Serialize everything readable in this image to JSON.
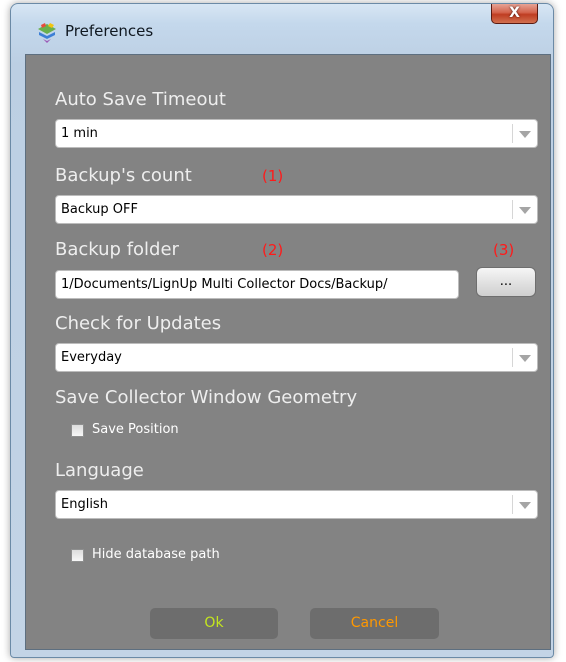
{
  "window": {
    "title": "Preferences",
    "close_glyph": "X",
    "icon": "app-multicolor-icon"
  },
  "auto_save": {
    "label": "Auto Save Timeout",
    "value": "1 min"
  },
  "backup_count": {
    "label": "Backup's count",
    "marker": "(1)",
    "value": "Backup OFF"
  },
  "backup_folder": {
    "label": "Backup folder",
    "marker": "(2)",
    "browse_marker": "(3)",
    "path": "1/Documents/LignUp Multi Collector Docs/Backup/",
    "browse_label": "..."
  },
  "updates": {
    "label": "Check for Updates",
    "value": "Everyday"
  },
  "geometry": {
    "label": "Save Collector Window Geometry",
    "save_position_label": "Save Position",
    "save_position_checked": false
  },
  "language": {
    "label": "Language",
    "value": "English"
  },
  "hide_db": {
    "label": "Hide database path",
    "checked": false
  },
  "buttons": {
    "ok": "Ok",
    "cancel": "Cancel"
  },
  "colors": {
    "marker": "#ff1a1a",
    "ok_text": "#c4e61e",
    "cancel_text": "#ff9800",
    "panel_bg": "#838383"
  }
}
